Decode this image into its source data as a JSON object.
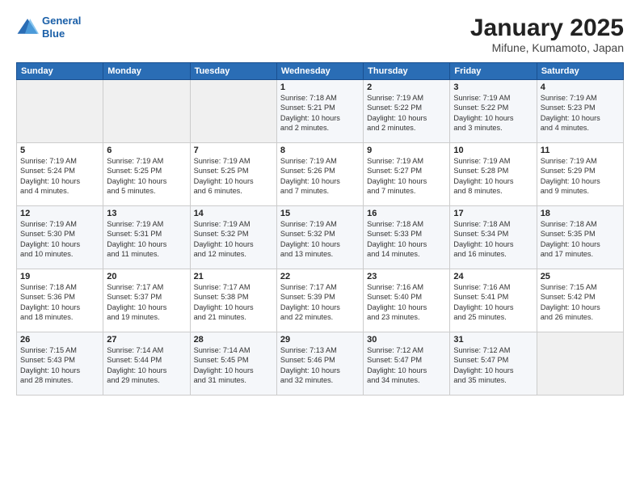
{
  "header": {
    "logo_line1": "General",
    "logo_line2": "Blue",
    "title": "January 2025",
    "subtitle": "Mifune, Kumamoto, Japan"
  },
  "weekdays": [
    "Sunday",
    "Monday",
    "Tuesday",
    "Wednesday",
    "Thursday",
    "Friday",
    "Saturday"
  ],
  "weeks": [
    [
      {
        "num": "",
        "info": ""
      },
      {
        "num": "",
        "info": ""
      },
      {
        "num": "",
        "info": ""
      },
      {
        "num": "1",
        "info": "Sunrise: 7:18 AM\nSunset: 5:21 PM\nDaylight: 10 hours\nand 2 minutes."
      },
      {
        "num": "2",
        "info": "Sunrise: 7:19 AM\nSunset: 5:22 PM\nDaylight: 10 hours\nand 2 minutes."
      },
      {
        "num": "3",
        "info": "Sunrise: 7:19 AM\nSunset: 5:22 PM\nDaylight: 10 hours\nand 3 minutes."
      },
      {
        "num": "4",
        "info": "Sunrise: 7:19 AM\nSunset: 5:23 PM\nDaylight: 10 hours\nand 4 minutes."
      }
    ],
    [
      {
        "num": "5",
        "info": "Sunrise: 7:19 AM\nSunset: 5:24 PM\nDaylight: 10 hours\nand 4 minutes."
      },
      {
        "num": "6",
        "info": "Sunrise: 7:19 AM\nSunset: 5:25 PM\nDaylight: 10 hours\nand 5 minutes."
      },
      {
        "num": "7",
        "info": "Sunrise: 7:19 AM\nSunset: 5:25 PM\nDaylight: 10 hours\nand 6 minutes."
      },
      {
        "num": "8",
        "info": "Sunrise: 7:19 AM\nSunset: 5:26 PM\nDaylight: 10 hours\nand 7 minutes."
      },
      {
        "num": "9",
        "info": "Sunrise: 7:19 AM\nSunset: 5:27 PM\nDaylight: 10 hours\nand 7 minutes."
      },
      {
        "num": "10",
        "info": "Sunrise: 7:19 AM\nSunset: 5:28 PM\nDaylight: 10 hours\nand 8 minutes."
      },
      {
        "num": "11",
        "info": "Sunrise: 7:19 AM\nSunset: 5:29 PM\nDaylight: 10 hours\nand 9 minutes."
      }
    ],
    [
      {
        "num": "12",
        "info": "Sunrise: 7:19 AM\nSunset: 5:30 PM\nDaylight: 10 hours\nand 10 minutes."
      },
      {
        "num": "13",
        "info": "Sunrise: 7:19 AM\nSunset: 5:31 PM\nDaylight: 10 hours\nand 11 minutes."
      },
      {
        "num": "14",
        "info": "Sunrise: 7:19 AM\nSunset: 5:32 PM\nDaylight: 10 hours\nand 12 minutes."
      },
      {
        "num": "15",
        "info": "Sunrise: 7:19 AM\nSunset: 5:32 PM\nDaylight: 10 hours\nand 13 minutes."
      },
      {
        "num": "16",
        "info": "Sunrise: 7:18 AM\nSunset: 5:33 PM\nDaylight: 10 hours\nand 14 minutes."
      },
      {
        "num": "17",
        "info": "Sunrise: 7:18 AM\nSunset: 5:34 PM\nDaylight: 10 hours\nand 16 minutes."
      },
      {
        "num": "18",
        "info": "Sunrise: 7:18 AM\nSunset: 5:35 PM\nDaylight: 10 hours\nand 17 minutes."
      }
    ],
    [
      {
        "num": "19",
        "info": "Sunrise: 7:18 AM\nSunset: 5:36 PM\nDaylight: 10 hours\nand 18 minutes."
      },
      {
        "num": "20",
        "info": "Sunrise: 7:17 AM\nSunset: 5:37 PM\nDaylight: 10 hours\nand 19 minutes."
      },
      {
        "num": "21",
        "info": "Sunrise: 7:17 AM\nSunset: 5:38 PM\nDaylight: 10 hours\nand 21 minutes."
      },
      {
        "num": "22",
        "info": "Sunrise: 7:17 AM\nSunset: 5:39 PM\nDaylight: 10 hours\nand 22 minutes."
      },
      {
        "num": "23",
        "info": "Sunrise: 7:16 AM\nSunset: 5:40 PM\nDaylight: 10 hours\nand 23 minutes."
      },
      {
        "num": "24",
        "info": "Sunrise: 7:16 AM\nSunset: 5:41 PM\nDaylight: 10 hours\nand 25 minutes."
      },
      {
        "num": "25",
        "info": "Sunrise: 7:15 AM\nSunset: 5:42 PM\nDaylight: 10 hours\nand 26 minutes."
      }
    ],
    [
      {
        "num": "26",
        "info": "Sunrise: 7:15 AM\nSunset: 5:43 PM\nDaylight: 10 hours\nand 28 minutes."
      },
      {
        "num": "27",
        "info": "Sunrise: 7:14 AM\nSunset: 5:44 PM\nDaylight: 10 hours\nand 29 minutes."
      },
      {
        "num": "28",
        "info": "Sunrise: 7:14 AM\nSunset: 5:45 PM\nDaylight: 10 hours\nand 31 minutes."
      },
      {
        "num": "29",
        "info": "Sunrise: 7:13 AM\nSunset: 5:46 PM\nDaylight: 10 hours\nand 32 minutes."
      },
      {
        "num": "30",
        "info": "Sunrise: 7:12 AM\nSunset: 5:47 PM\nDaylight: 10 hours\nand 34 minutes."
      },
      {
        "num": "31",
        "info": "Sunrise: 7:12 AM\nSunset: 5:47 PM\nDaylight: 10 hours\nand 35 minutes."
      },
      {
        "num": "",
        "info": ""
      }
    ]
  ]
}
